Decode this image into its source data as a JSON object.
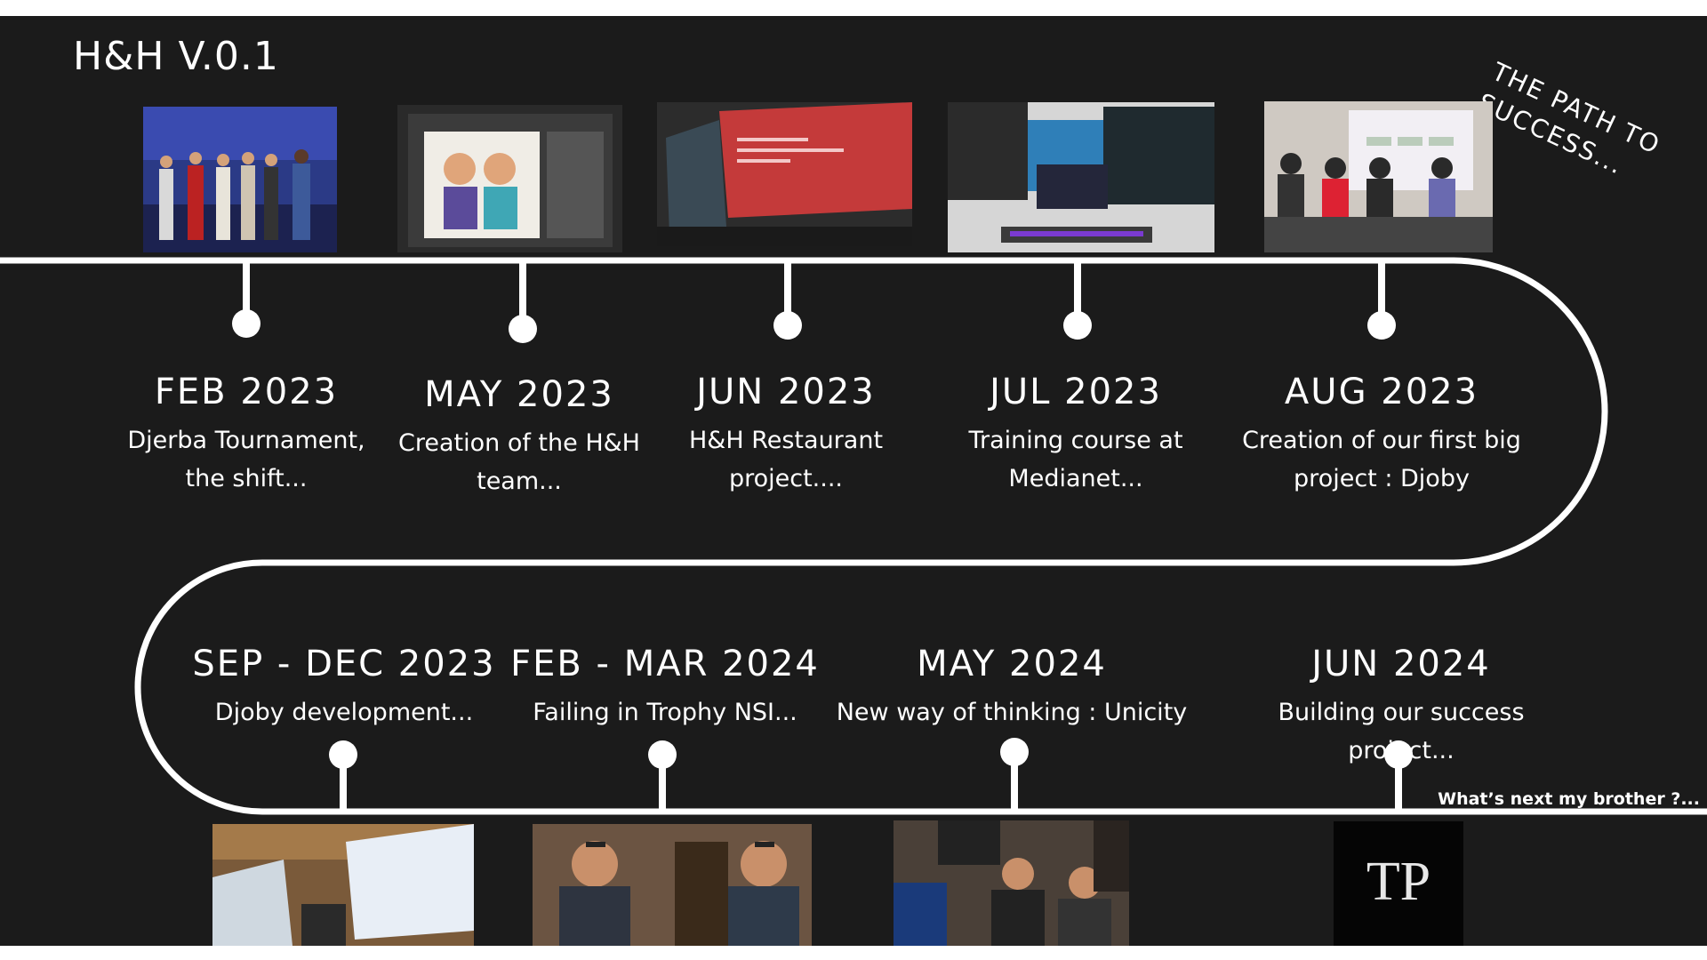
{
  "header": {
    "title": "H&H V.0.1",
    "tagline_line1": "THE PATH TO",
    "tagline_line2": "SUCCESS..."
  },
  "footer_note": "What’s next my brother ?...",
  "colors": {
    "background": "#1b1b1b",
    "foreground": "#ffffff"
  },
  "timeline": {
    "top": [
      {
        "date": "FEB 2023",
        "desc_line1": "Djerba Tournament,",
        "desc_line2": "the shift..."
      },
      {
        "date": "MAY 2023",
        "desc_line1": "Creation of the H&H",
        "desc_line2": "team..."
      },
      {
        "date": "JUN 2023",
        "desc_line1": "H&H Restaurant",
        "desc_line2": "project...."
      },
      {
        "date": "JUL 2023",
        "desc_line1": "Training course at",
        "desc_line2": "Medianet..."
      },
      {
        "date": "AUG 2023",
        "desc_line1": "Creation of our first big",
        "desc_line2": "project : Djoby"
      }
    ],
    "bottom": [
      {
        "date": "SEP - DEC 2023",
        "desc": "Djoby development..."
      },
      {
        "date": "FEB - MAR 2024",
        "desc": "Failing in Trophy NSI..."
      },
      {
        "date": "MAY 2024",
        "desc": "New way of thinking : Unicity"
      },
      {
        "date": "JUN 2024",
        "desc": "Building our success project..."
      }
    ]
  },
  "logo": {
    "text": "TP"
  }
}
